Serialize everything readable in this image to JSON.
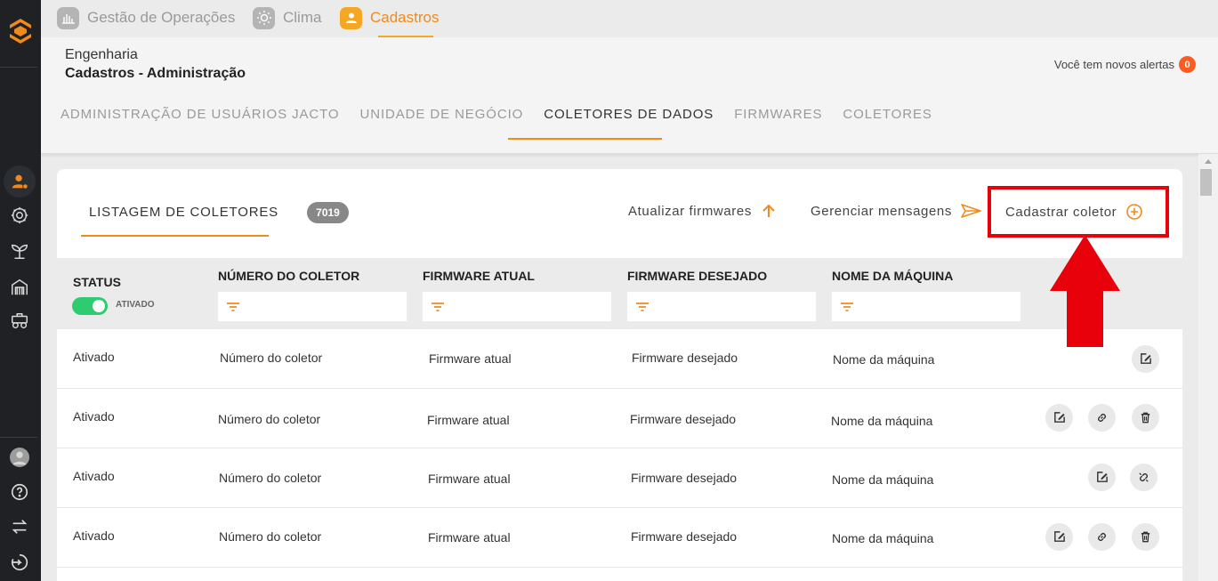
{
  "app_tabs": [
    {
      "label": "Gestão de Operações",
      "icon": "building-chart-icon"
    },
    {
      "label": "Clima",
      "icon": "sun-icon"
    },
    {
      "label": "Cadastros",
      "icon": "user-icon"
    }
  ],
  "header": {
    "crumb": "Engenharia",
    "title": "Cadastros - Administração",
    "alerts_text": "Você tem novos alertas",
    "alerts_count": "0"
  },
  "subtabs": [
    "ADMINISTRAÇÃO DE USUÁRIOS JACTO",
    "UNIDADE DE NEGÓCIO",
    "COLETORES DE DADOS",
    "FIRMWARES",
    "COLETORES"
  ],
  "list": {
    "title": "LISTAGEM DE COLETORES",
    "count": "7019"
  },
  "actions": {
    "update": "Atualizar firmwares",
    "messages": "Gerenciar mensagens",
    "register": "Cadastrar coletor"
  },
  "table": {
    "headers": {
      "status": "STATUS",
      "numero": "NÚMERO DO COLETOR",
      "fw_atual": "FIRMWARE ATUAL",
      "fw_desejado": "FIRMWARE DESEJADO",
      "maquina": "NOME DA MÁQUINA"
    },
    "status_toggle_label": "ATIVADO",
    "rows": [
      {
        "status": "Ativado",
        "numero": "Número do coletor",
        "fw_atual": "Firmware atual",
        "fw_desejado": "Firmware desejado",
        "maquina": "Nome da máquina"
      },
      {
        "status": "Ativado",
        "numero": "Número do coletor",
        "fw_atual": "Firmware atual",
        "fw_desejado": "Firmware desejado",
        "maquina": "Nome da máquina"
      },
      {
        "status": "Ativado",
        "numero": "Número do coletor",
        "fw_atual": "Firmware atual",
        "fw_desejado": "Firmware desejado",
        "maquina": "Nome da máquina"
      },
      {
        "status": "Ativado",
        "numero": "Número do coletor",
        "fw_atual": "Firmware atual",
        "fw_desejado": "Firmware desejado",
        "maquina": "Nome da máquina"
      }
    ]
  },
  "colors": {
    "accent": "#f08a1c",
    "sidebar": "#1f2125",
    "annotation_red": "#e8000b",
    "toggle_on": "#2ecc71"
  }
}
